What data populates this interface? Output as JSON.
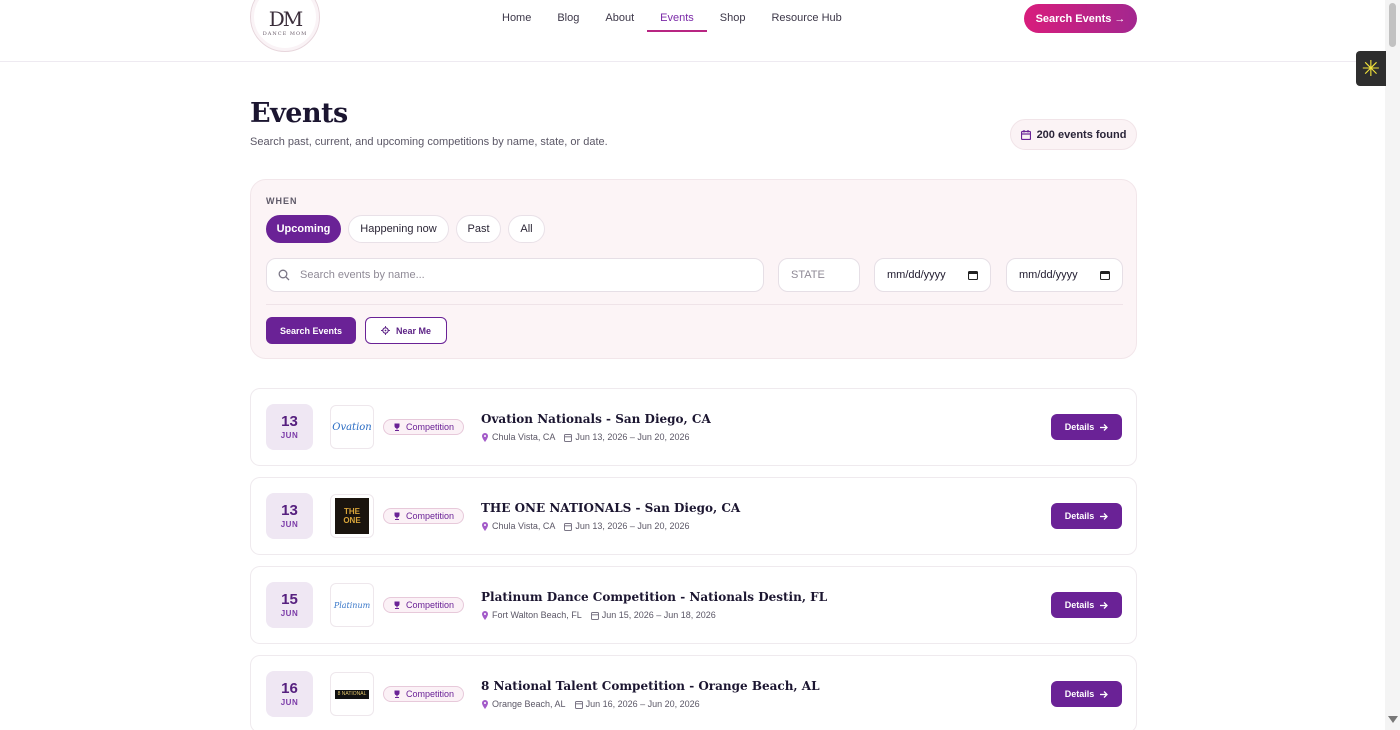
{
  "header": {
    "logo": {
      "monogram": "DM",
      "subtitle": "DANCE MOM"
    },
    "nav": [
      "Home",
      "Blog",
      "About",
      "Events",
      "Shop",
      "Resource Hub"
    ],
    "active_nav": "Events",
    "cta_label": "Search Events →"
  },
  "page": {
    "title": "Events",
    "subtitle": "Search past, current, and upcoming competitions by name, state, or date.",
    "count_label": "200 events found"
  },
  "filters": {
    "when_label": "WHEN",
    "pills": [
      "Upcoming",
      "Happening now",
      "Past",
      "All"
    ],
    "active_pill": "Upcoming",
    "search_placeholder": "Search events by name...",
    "state_placeholder": "STATE",
    "date_start_placeholder": "mm/dd/yyyy",
    "date_end_placeholder": "mm/dd/yyyy",
    "search_button": "Search Events",
    "near_me_button": "Near Me"
  },
  "events": [
    {
      "day": "13",
      "month": "JUN",
      "logo_text": "Ovation",
      "tag": "Competition",
      "title": "Ovation Nationals - San Diego, CA",
      "location": "Chula Vista, CA",
      "dates": "Jun 13, 2026 – Jun 20, 2026",
      "details_label": "Details"
    },
    {
      "day": "13",
      "month": "JUN",
      "logo_text": "THE ONE",
      "tag": "Competition",
      "title": "THE ONE NATIONALS - San Diego, CA",
      "location": "Chula Vista, CA",
      "dates": "Jun 13, 2026 – Jun 20, 2026",
      "details_label": "Details"
    },
    {
      "day": "15",
      "month": "JUN",
      "logo_text": "Platinum",
      "tag": "Competition",
      "title": "Platinum Dance Competition - Nationals Destin, FL",
      "location": "Fort Walton Beach, FL",
      "dates": "Jun 15, 2026 – Jun 18, 2026",
      "details_label": "Details"
    },
    {
      "day": "16",
      "month": "JUN",
      "logo_text": "8 NATIONAL",
      "tag": "Competition",
      "title": "8 National Talent Competition - Orange Beach, AL",
      "location": "Orange Beach, AL",
      "dates": "Jun 16, 2026 – Jun 20, 2026",
      "details_label": "Details"
    }
  ],
  "colors": {
    "brand_purple": "#6a2296",
    "brand_pink": "#d81d7c",
    "panel_bg": "#fcf4f6"
  }
}
